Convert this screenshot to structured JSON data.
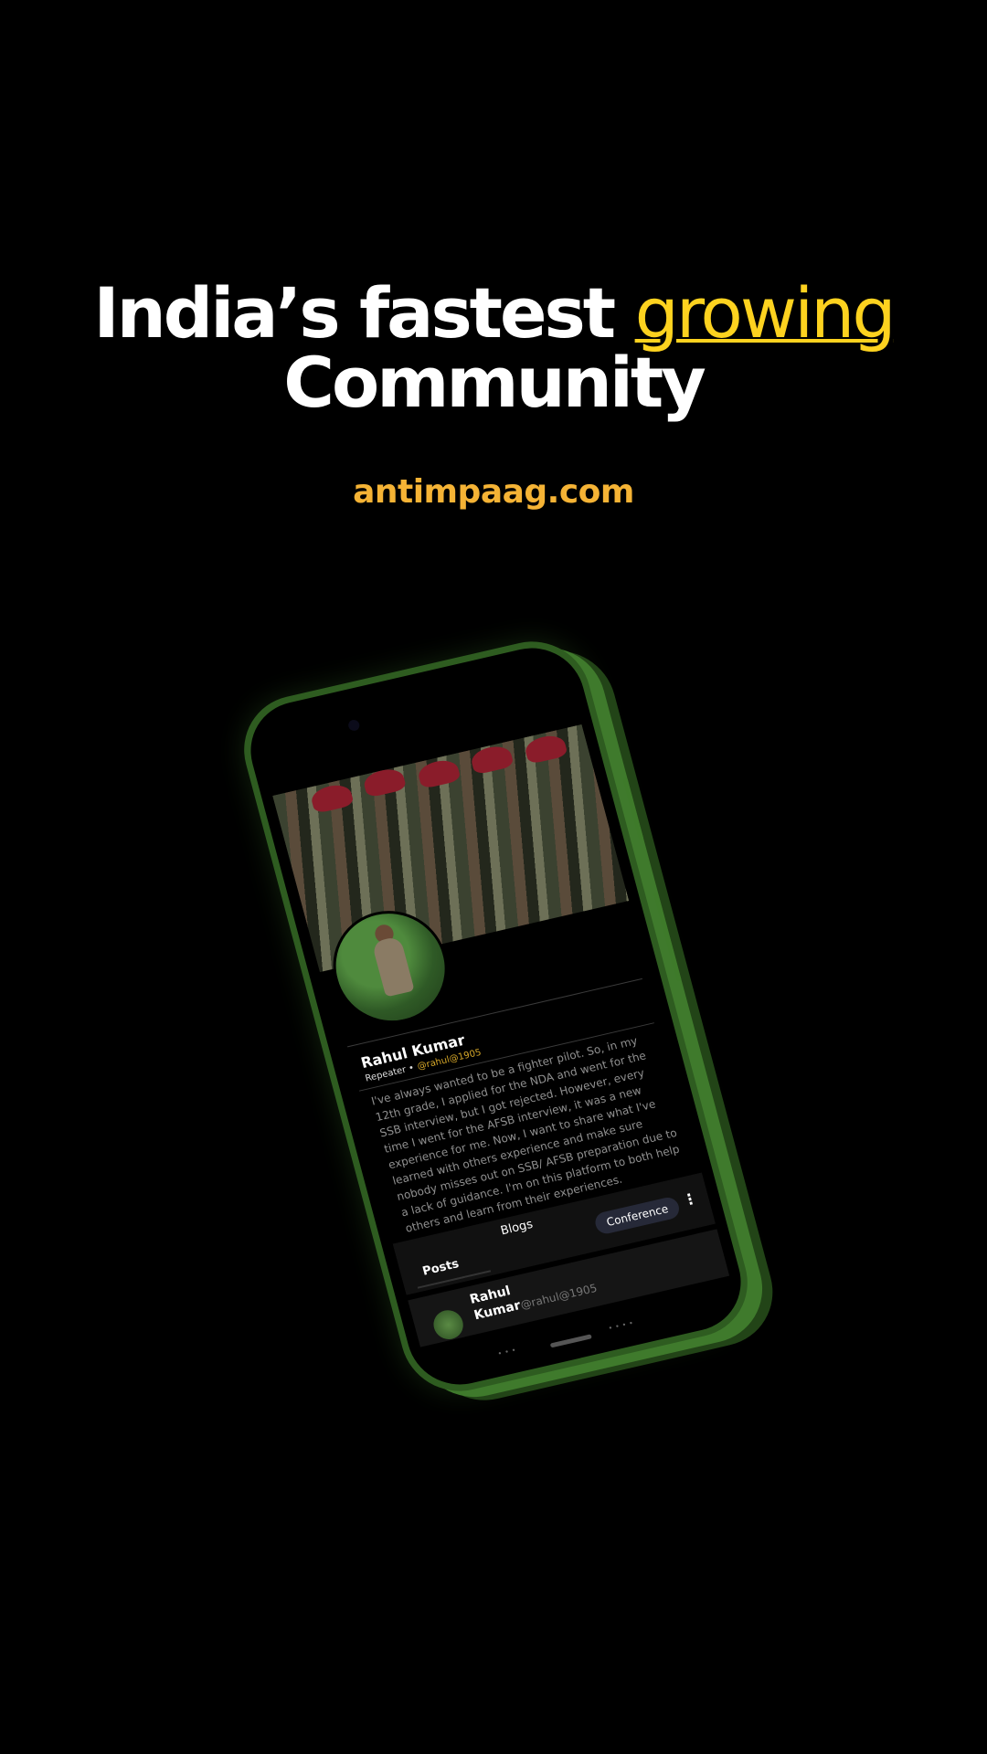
{
  "headline": {
    "part1": "India’s fastest ",
    "accent": "growing",
    "line2": "Community"
  },
  "site": "antimpaag.com",
  "colors": {
    "accent": "#fdd21f",
    "site": "#f5b335",
    "phone": "#2e5c20",
    "background": "#000000"
  },
  "profile": {
    "name": "Rahul Kumar",
    "role": "Repeater •",
    "handle": "@rahul@1905",
    "bio": "I've always wanted to be a fighter pilot. So, in my 12th grade, I applied for the NDA and went for the SSB interview, but I got rejected. However, every time I went for the AFSB interview, it was a new experience for me. Now, I want to share what I've learned with others experience and make sure nobody misses out on SSB/ AFSB preparation due to a lack of guidance. I'm on this platform to both help others and learn from their experiences."
  },
  "tabs": {
    "posts": "Posts",
    "blogs": "Blogs"
  },
  "conference_button": "Conference",
  "post": {
    "name": "Rahul Kumar",
    "handle": "@rahul@1905"
  },
  "icons": [
    "more-vertical-icon",
    "resize-grip-icon",
    "camera-icon"
  ]
}
